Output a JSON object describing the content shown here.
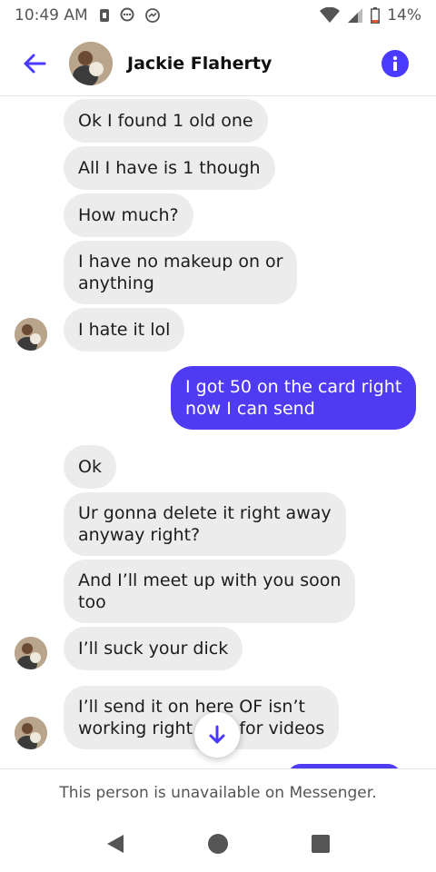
{
  "status_bar": {
    "time": "10:49 AM",
    "battery": "14%",
    "icons": [
      "sim-card-icon",
      "messenger-bubble-icon",
      "messenger-icon",
      "wifi-icon",
      "signal-icon",
      "battery-icon"
    ]
  },
  "header": {
    "contact_name": "Jackie Flaherty",
    "back_icon": "back-arrow-icon",
    "info_icon": "info-icon",
    "accent_color": "#4a3aff"
  },
  "messages": [
    {
      "from": "them",
      "text": "Ok I found 1 old one"
    },
    {
      "from": "them",
      "text": "All I have is 1 though"
    },
    {
      "from": "them",
      "text": "How much?"
    },
    {
      "from": "them",
      "text": "I have no makeup on or\nanything"
    },
    {
      "from": "them",
      "text": "I hate it lol"
    },
    {
      "from": "me",
      "text": "I got 50 on the card right\nnow I can send"
    },
    {
      "from": "them",
      "text": "Ok"
    },
    {
      "from": "them",
      "text": "Ur gonna delete it right away\nanyway right?"
    },
    {
      "from": "them",
      "text": "And I’ll meet up with you soon\ntoo"
    },
    {
      "from": "them",
      "text": "I’ll suck your dick"
    },
    {
      "from": "them",
      "text": "I’ll send it on here OF isn’t\nworking right now for videos"
    }
  ],
  "footer": {
    "notice": "This person is unavailable on Messenger."
  },
  "colors": {
    "incoming_bubble": "#ececec",
    "outgoing_bubble": "#4f3bf1"
  }
}
